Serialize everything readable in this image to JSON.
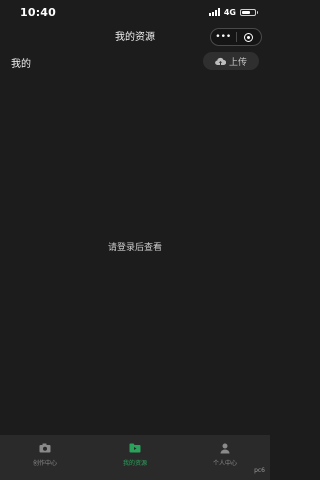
{
  "status_bar": {
    "time": "10:40",
    "network": "4G",
    "battery_level": 0.7
  },
  "nav": {
    "title": "我的资源"
  },
  "section": {
    "title": "我的",
    "upload_label": "上传"
  },
  "empty_state": {
    "text": "请登录后查看"
  },
  "tabs": [
    {
      "label": "创作中心",
      "icon": "camera-icon",
      "active": false
    },
    {
      "label": "我的资源",
      "icon": "folder-icon",
      "active": true
    },
    {
      "label": "个人中心",
      "icon": "person-icon",
      "active": false
    }
  ],
  "colors": {
    "accent": "#2ba25b",
    "background": "#1c1c1c",
    "tab_bar": "#2a2a2a"
  },
  "watermark": "pc6"
}
